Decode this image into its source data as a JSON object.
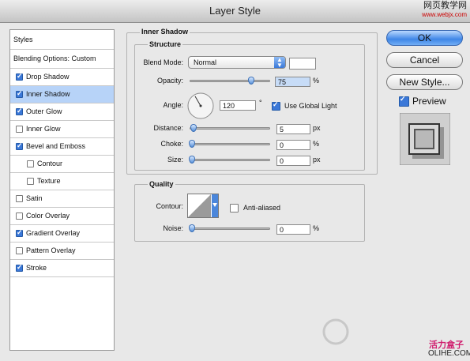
{
  "window": {
    "title": "Layer Style"
  },
  "watermark": {
    "site_cn": "网页教学网",
    "site_url": "www.webjx.com",
    "bottom_cn": "活力盒子",
    "bottom_en": "OLIHE.COM"
  },
  "sidebar": {
    "items": [
      {
        "label": "Styles",
        "checkbox": false
      },
      {
        "label": "Blending Options: Custom",
        "checkbox": false
      },
      {
        "label": "Drop Shadow",
        "checkbox": true,
        "checked": true
      },
      {
        "label": "Inner Shadow",
        "checkbox": true,
        "checked": true,
        "selected": true
      },
      {
        "label": "Outer Glow",
        "checkbox": true,
        "checked": true
      },
      {
        "label": "Inner Glow",
        "checkbox": true,
        "checked": false
      },
      {
        "label": "Bevel and Emboss",
        "checkbox": true,
        "checked": true
      },
      {
        "label": "Contour",
        "checkbox": true,
        "checked": false,
        "indent": true
      },
      {
        "label": "Texture",
        "checkbox": true,
        "checked": false,
        "indent": true
      },
      {
        "label": "Satin",
        "checkbox": true,
        "checked": false
      },
      {
        "label": "Color Overlay",
        "checkbox": true,
        "checked": false
      },
      {
        "label": "Gradient Overlay",
        "checkbox": true,
        "checked": true
      },
      {
        "label": "Pattern Overlay",
        "checkbox": true,
        "checked": false
      },
      {
        "label": "Stroke",
        "checkbox": true,
        "checked": true
      }
    ]
  },
  "inner_shadow": {
    "section_title": "Inner Shadow",
    "structure": {
      "title": "Structure",
      "blend_mode_label": "Blend Mode:",
      "blend_mode_value": "Normal",
      "color_swatch": "#ffffff",
      "opacity_label": "Opacity:",
      "opacity_value": "75",
      "opacity_unit": "%",
      "opacity_fraction": 0.75,
      "angle_label": "Angle:",
      "angle_value": "120",
      "angle_unit": "°",
      "use_global_light_label": "Use Global Light",
      "use_global_light_checked": true,
      "distance_label": "Distance:",
      "distance_value": "5",
      "distance_unit": "px",
      "choke_label": "Choke:",
      "choke_value": "0",
      "choke_unit": "%",
      "size_label": "Size:",
      "size_value": "0",
      "size_unit": "px"
    },
    "quality": {
      "title": "Quality",
      "contour_label": "Contour:",
      "anti_aliased_label": "Anti-aliased",
      "anti_aliased_checked": false,
      "noise_label": "Noise:",
      "noise_value": "0",
      "noise_unit": "%"
    }
  },
  "buttons": {
    "ok": "OK",
    "cancel": "Cancel",
    "new_style": "New Style..."
  },
  "preview": {
    "label": "Preview",
    "checked": true
  },
  "colors": {
    "accent": "#3b78d8",
    "selection": "#b7d3f8"
  }
}
